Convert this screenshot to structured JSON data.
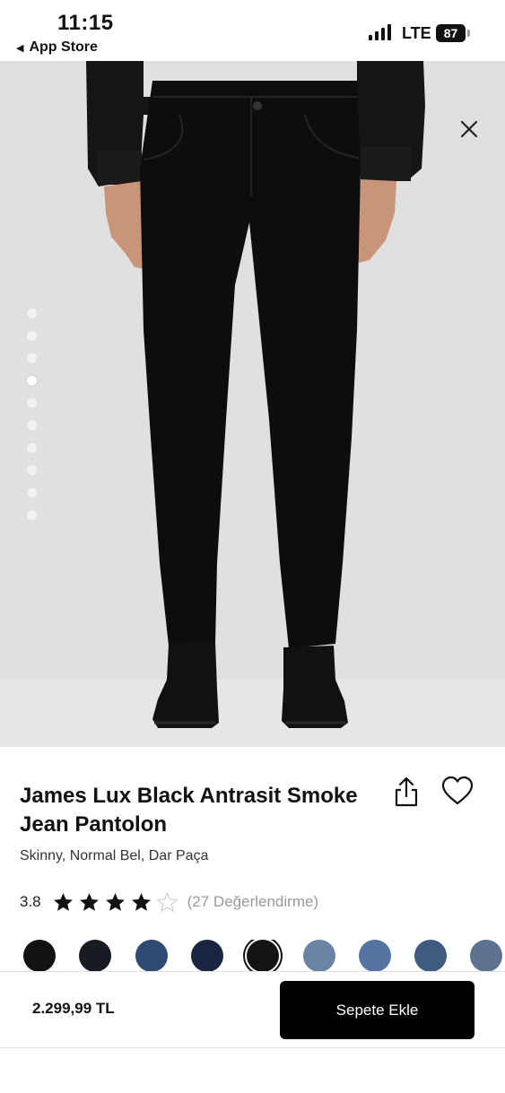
{
  "status_bar": {
    "time": "11:15",
    "back_label": "App Store",
    "network": "LTE",
    "battery": "87"
  },
  "gallery": {
    "image_count": 10,
    "active_index": 3,
    "close_icon": "close-icon"
  },
  "product": {
    "title": "James Lux Black Antrasit Smoke Jean Pantolon",
    "subtitle": "Skinny, Normal Bel, Dar Paça",
    "rating": {
      "value": "3.8",
      "filled_stars": 4,
      "total_stars": 5,
      "count_text": "(27 Değerlendirme)"
    },
    "share_icon": "share-icon",
    "favorite_icon": "heart-icon"
  },
  "color_swatches": [
    {
      "color": "#101214",
      "selected": false
    },
    {
      "color": "#171b24",
      "selected": false
    },
    {
      "color": "#2e4a72",
      "selected": false
    },
    {
      "color": "#1a2640",
      "selected": false
    },
    {
      "color": "#141414",
      "selected": true
    },
    {
      "color": "#6a84a6",
      "selected": false
    },
    {
      "color": "#5575a0",
      "selected": false
    },
    {
      "color": "#3f5b7e",
      "selected": false
    },
    {
      "color": "#5d7290",
      "selected": false
    }
  ],
  "bottom_bar": {
    "price": "2.299,99 TL",
    "add_to_cart": "Sepete Ekle"
  },
  "colors": {
    "accent": "#000000",
    "star": "#111111",
    "muted": "#999999"
  }
}
